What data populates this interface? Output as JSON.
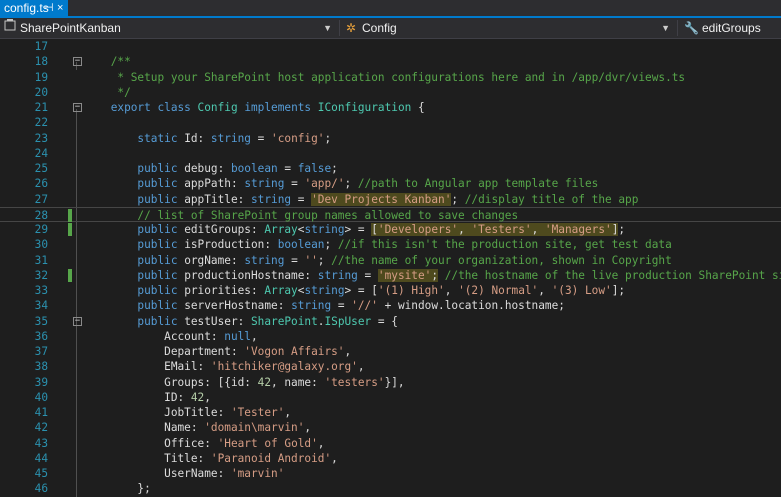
{
  "tab": {
    "title": "config.ts",
    "pin": "⊣",
    "close": "×"
  },
  "navbar": {
    "project": "SharePointKanban",
    "class": "Config",
    "member": "editGroups"
  },
  "lines": [
    {
      "num": "17",
      "parts": []
    },
    {
      "num": "18",
      "fold": "−",
      "parts": [
        [
          "c",
          "    /**"
        ]
      ]
    },
    {
      "num": "19",
      "parts": [
        [
          "c",
          "     * Setup your SharePoint host application configurations here and in /app/dvr/views.ts"
        ]
      ]
    },
    {
      "num": "20",
      "parts": [
        [
          "c",
          "     */"
        ]
      ]
    },
    {
      "num": "21",
      "fold": "−",
      "parts": [
        [
          "k",
          "    export class "
        ],
        [
          "ty",
          "Config "
        ],
        [
          "k",
          "implements "
        ],
        [
          "ty",
          "IConfiguration "
        ],
        [
          "",
          "{"
        ]
      ]
    },
    {
      "num": "22",
      "parts": []
    },
    {
      "num": "23",
      "parts": [
        [
          "k",
          "        static "
        ],
        [
          "",
          "Id: "
        ],
        [
          "k",
          "string "
        ],
        [
          "",
          "= "
        ],
        [
          "s",
          "'config'"
        ],
        [
          "",
          ";"
        ]
      ]
    },
    {
      "num": "24",
      "parts": []
    },
    {
      "num": "25",
      "parts": [
        [
          "k",
          "        public "
        ],
        [
          "",
          "debug: "
        ],
        [
          "k",
          "boolean "
        ],
        [
          "",
          "= "
        ],
        [
          "k",
          "false"
        ],
        [
          "",
          ";"
        ]
      ]
    },
    {
      "num": "26",
      "parts": [
        [
          "k",
          "        public "
        ],
        [
          "",
          "appPath: "
        ],
        [
          "k",
          "string "
        ],
        [
          "",
          "= "
        ],
        [
          "s",
          "'app/'"
        ],
        [
          "",
          "; "
        ],
        [
          "c",
          "//path to Angular app template files"
        ]
      ]
    },
    {
      "num": "27",
      "parts": [
        [
          "k",
          "        public "
        ],
        [
          "",
          "appTitle: "
        ],
        [
          "k",
          "string "
        ],
        [
          "",
          "= "
        ],
        [
          "hs",
          "'Dev Projects Kanban'"
        ],
        [
          "",
          "; "
        ],
        [
          "c",
          "//display title of the app"
        ]
      ]
    },
    {
      "num": "28",
      "current": true,
      "changed": true,
      "parts": [
        [
          "c",
          "        // list of SharePoint group names allowed to save changes"
        ]
      ]
    },
    {
      "num": "29",
      "changed": true,
      "parts": [
        [
          "k",
          "        public "
        ],
        [
          "",
          "editGroups: "
        ],
        [
          "ty",
          "Array"
        ],
        [
          "",
          "<"
        ],
        [
          "k",
          "string"
        ],
        [
          "",
          "> = "
        ],
        [
          "hl",
          "["
        ],
        [
          "hs",
          "'Developers'"
        ],
        [
          "hl",
          ", "
        ],
        [
          "hs",
          "'Testers'"
        ],
        [
          "hl",
          ", "
        ],
        [
          "hs",
          "'Managers'"
        ],
        [
          "hl",
          "]"
        ],
        [
          "",
          ";"
        ]
      ]
    },
    {
      "num": "30",
      "parts": [
        [
          "k",
          "        public "
        ],
        [
          "",
          "isProduction: "
        ],
        [
          "k",
          "boolean"
        ],
        [
          "",
          "; "
        ],
        [
          "c",
          "//if this isn't the production site, get test data"
        ]
      ]
    },
    {
      "num": "31",
      "parts": [
        [
          "k",
          "        public "
        ],
        [
          "",
          "orgName: "
        ],
        [
          "k",
          "string "
        ],
        [
          "",
          "= "
        ],
        [
          "s",
          "''"
        ],
        [
          "",
          "; "
        ],
        [
          "c",
          "//the name of your organization, shown in Copyright"
        ]
      ]
    },
    {
      "num": "32",
      "changed": true,
      "parts": [
        [
          "k",
          "        public "
        ],
        [
          "",
          "productionHostname: "
        ],
        [
          "k",
          "string "
        ],
        [
          "",
          "= "
        ],
        [
          "hs",
          "'mysite'"
        ],
        [
          "hl",
          ";"
        ],
        [
          "c",
          " //the hostname of the live production SharePoint site"
        ]
      ]
    },
    {
      "num": "33",
      "parts": [
        [
          "k",
          "        public "
        ],
        [
          "",
          "priorities: "
        ],
        [
          "ty",
          "Array"
        ],
        [
          "",
          "<"
        ],
        [
          "k",
          "string"
        ],
        [
          "",
          "> = ["
        ],
        [
          "s",
          "'(1) High'"
        ],
        [
          "",
          ", "
        ],
        [
          "s",
          "'(2) Normal'"
        ],
        [
          "",
          ", "
        ],
        [
          "s",
          "'(3) Low'"
        ],
        [
          "",
          "];"
        ]
      ]
    },
    {
      "num": "34",
      "parts": [
        [
          "k",
          "        public "
        ],
        [
          "",
          "serverHostname: "
        ],
        [
          "k",
          "string "
        ],
        [
          "",
          "= "
        ],
        [
          "s",
          "'//' "
        ],
        [
          "",
          "+ window.location.hostname;"
        ]
      ]
    },
    {
      "num": "35",
      "fold": "−",
      "parts": [
        [
          "k",
          "        public "
        ],
        [
          "",
          "testUser: "
        ],
        [
          "ty",
          "SharePoint"
        ],
        [
          "",
          "."
        ],
        [
          "ty",
          "ISpUser "
        ],
        [
          "",
          "= {"
        ]
      ]
    },
    {
      "num": "36",
      "parts": [
        [
          "",
          "            Account: "
        ],
        [
          "k",
          "null"
        ],
        [
          "",
          ","
        ]
      ]
    },
    {
      "num": "37",
      "parts": [
        [
          "",
          "            Department: "
        ],
        [
          "s",
          "'Vogon Affairs'"
        ],
        [
          "",
          ","
        ]
      ]
    },
    {
      "num": "38",
      "parts": [
        [
          "",
          "            EMail: "
        ],
        [
          "s",
          "'hitchiker@galaxy.org'"
        ],
        [
          "",
          ","
        ]
      ]
    },
    {
      "num": "39",
      "parts": [
        [
          "",
          "            Groups: [{id: "
        ],
        [
          "n",
          "42"
        ],
        [
          "",
          ", name: "
        ],
        [
          "s",
          "'testers'"
        ],
        [
          "",
          "}],"
        ]
      ]
    },
    {
      "num": "40",
      "parts": [
        [
          "",
          "            ID: "
        ],
        [
          "n",
          "42"
        ],
        [
          "",
          ","
        ]
      ]
    },
    {
      "num": "41",
      "parts": [
        [
          "",
          "            JobTitle: "
        ],
        [
          "s",
          "'Tester'"
        ],
        [
          "",
          ","
        ]
      ]
    },
    {
      "num": "42",
      "parts": [
        [
          "",
          "            Name: "
        ],
        [
          "s",
          "'domain\\marvin'"
        ],
        [
          "",
          ","
        ]
      ]
    },
    {
      "num": "43",
      "parts": [
        [
          "",
          "            Office: "
        ],
        [
          "s",
          "'Heart of Gold'"
        ],
        [
          "",
          ","
        ]
      ]
    },
    {
      "num": "44",
      "parts": [
        [
          "",
          "            Title: "
        ],
        [
          "s",
          "'Paranoid Android'"
        ],
        [
          "",
          ","
        ]
      ]
    },
    {
      "num": "45",
      "parts": [
        [
          "",
          "            UserName: "
        ],
        [
          "s",
          "'marvin'"
        ]
      ]
    },
    {
      "num": "46",
      "parts": [
        [
          "",
          "        };"
        ]
      ]
    }
  ]
}
